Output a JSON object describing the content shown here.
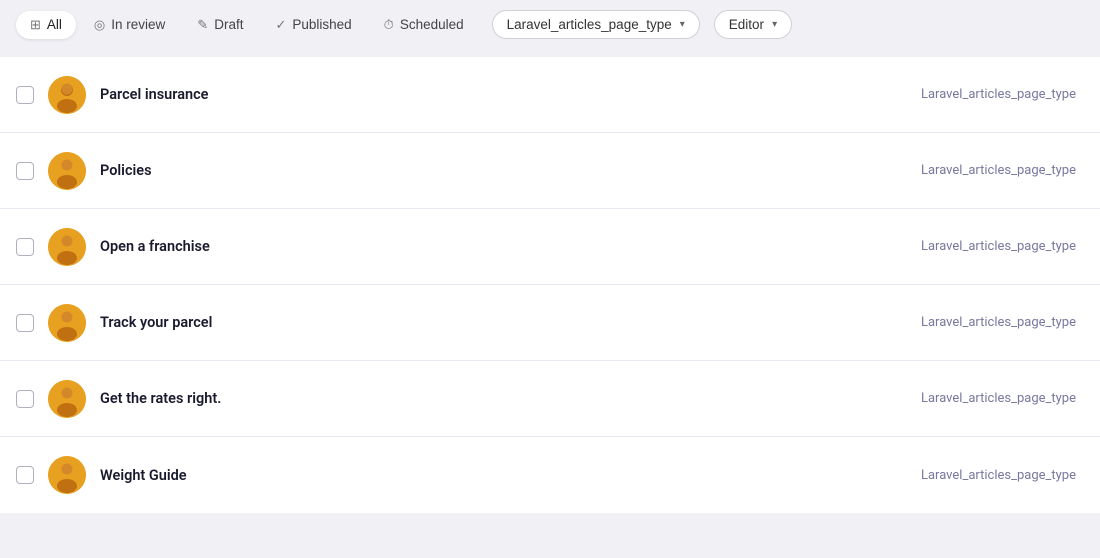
{
  "filterBar": {
    "filters": [
      {
        "id": "all",
        "label": "All",
        "icon": "layers-icon",
        "active": true
      },
      {
        "id": "in-review",
        "label": "In review",
        "icon": "circle-dots-icon",
        "active": false
      },
      {
        "id": "draft",
        "label": "Draft",
        "icon": "pencil-icon",
        "active": false
      },
      {
        "id": "published",
        "label": "Published",
        "icon": "check-icon",
        "active": false
      },
      {
        "id": "scheduled",
        "label": "Scheduled",
        "icon": "clock-icon",
        "active": false
      }
    ],
    "dropdowns": [
      {
        "id": "page-type",
        "label": "Laravel_articles_page_type"
      },
      {
        "id": "editor",
        "label": "Editor"
      }
    ]
  },
  "table": {
    "rows": [
      {
        "id": 1,
        "title": "Parcel insurance",
        "type": "Laravel_articles_page_type"
      },
      {
        "id": 2,
        "title": "Policies",
        "type": "Laravel_articles_page_type"
      },
      {
        "id": 3,
        "title": "Open a franchise",
        "type": "Laravel_articles_page_type"
      },
      {
        "id": 4,
        "title": "Track your parcel",
        "type": "Laravel_articles_page_type"
      },
      {
        "id": 5,
        "title": "Get the rates right.",
        "type": "Laravel_articles_page_type"
      },
      {
        "id": 6,
        "title": "Weight Guide",
        "type": "Laravel_articles_page_type"
      }
    ]
  },
  "icons": {
    "layers": "⊞",
    "circle_dots": "◎",
    "pencil": "✎",
    "check": "✓",
    "clock": "🕐",
    "chevron_down": "▾"
  },
  "colors": {
    "accent": "#7878a0",
    "active_bg": "#ffffff",
    "avatar_bg": "#e8a020"
  }
}
